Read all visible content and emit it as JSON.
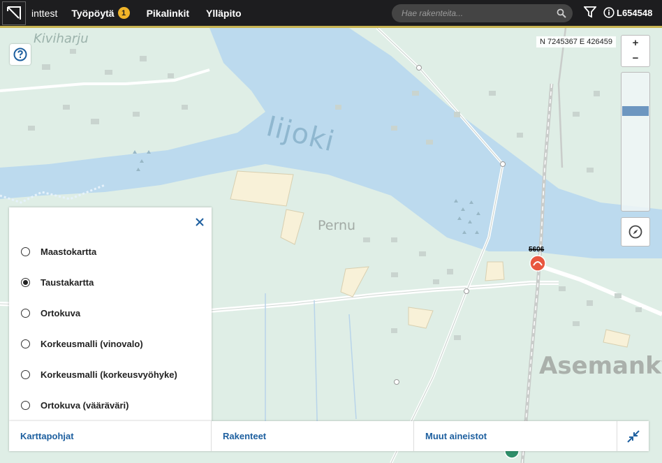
{
  "app": {
    "name": "inttest",
    "user_id": "L654548"
  },
  "nav": {
    "items": [
      {
        "label": "Työpöytä",
        "badge": "1"
      },
      {
        "label": "Pikalinkit"
      },
      {
        "label": "Ylläpito"
      }
    ]
  },
  "search": {
    "placeholder": "Hae rakenteita..."
  },
  "map": {
    "coordinates": "N 7245367 E 426459",
    "labels": {
      "kiviharju": "Kiviharju",
      "river": "Iijoki",
      "pernu": "Pernu",
      "asemakyla": "Asemankylä",
      "structure": "5606"
    },
    "zoom_level": 0.26
  },
  "layers_panel": {
    "options": [
      {
        "label": "Maastokartta",
        "checked": false
      },
      {
        "label": "Taustakartta",
        "checked": true
      },
      {
        "label": "Ortokuva",
        "checked": false
      },
      {
        "label": "Korkeusmalli (vinovalo)",
        "checked": false
      },
      {
        "label": "Korkeusmalli (korkeusvyöhyke)",
        "checked": false
      },
      {
        "label": "Ortokuva (vääräväri)",
        "checked": false
      }
    ]
  },
  "tabs": [
    {
      "label": "Karttapohjat"
    },
    {
      "label": "Rakenteet"
    },
    {
      "label": "Muut aineistot"
    }
  ],
  "colors": {
    "accent": "#1d5f9f",
    "topbar": "#1d1d1f",
    "badge": "#f0b429",
    "water": "#bcdaee",
    "land": "#dfeee6"
  },
  "icons": [
    "logo-icon",
    "search-icon",
    "filter-icon",
    "info-icon",
    "help-icon",
    "zoom-in-icon",
    "zoom-out-icon",
    "compass-icon",
    "close-icon",
    "collapse-icon",
    "structure-marker-icon"
  ]
}
